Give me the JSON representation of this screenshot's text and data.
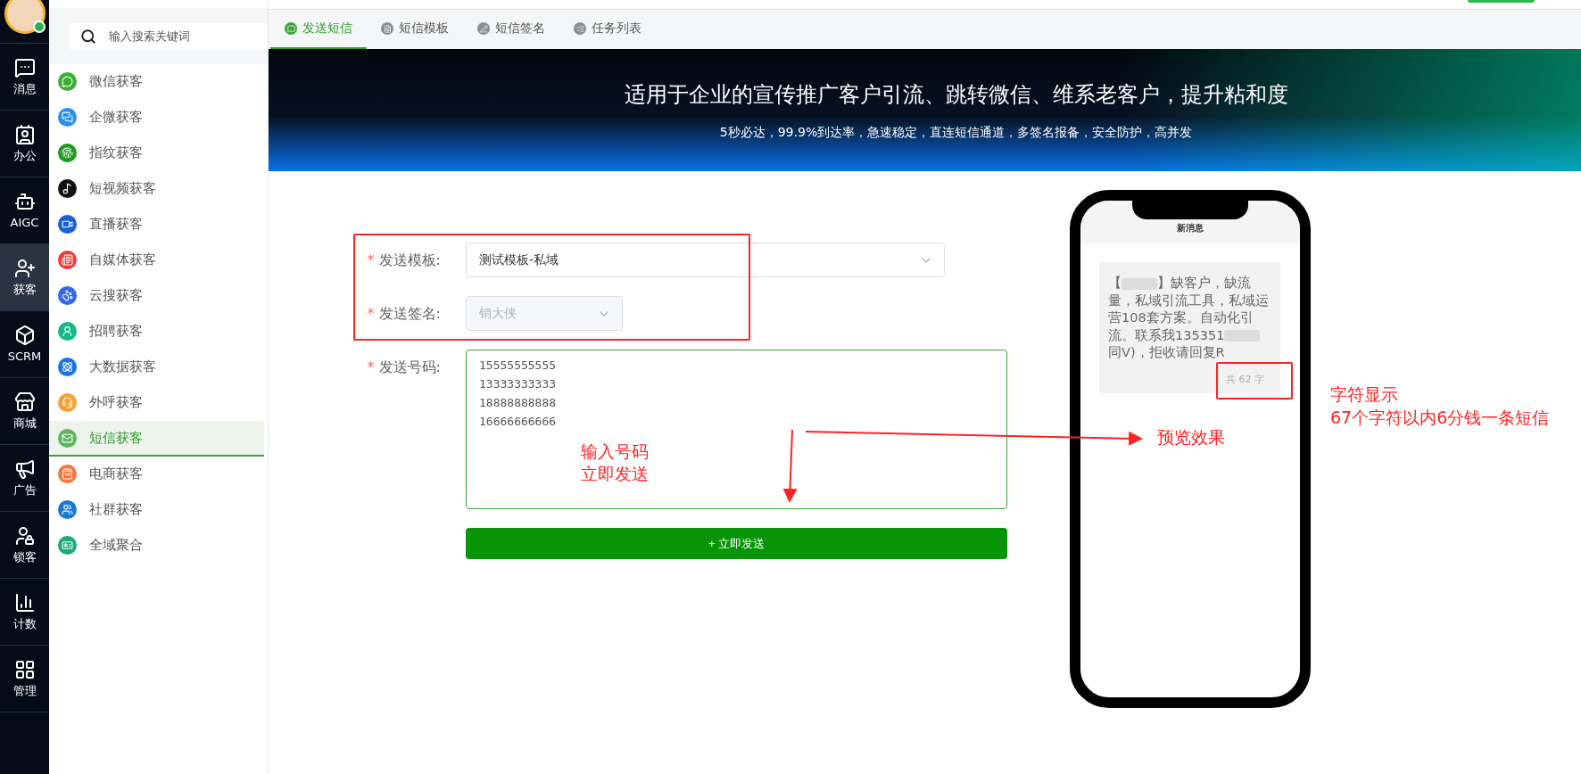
{
  "rail": {
    "items": [
      {
        "label": "消息",
        "selected": false
      },
      {
        "label": "办公",
        "selected": false
      },
      {
        "label": "AIGC",
        "selected": false
      },
      {
        "label": "获客",
        "selected": true
      },
      {
        "label": "SCRM",
        "selected": false
      },
      {
        "label": "商城",
        "selected": false
      },
      {
        "label": "广告",
        "selected": false
      },
      {
        "label": "锁客",
        "selected": false
      },
      {
        "label": "计数",
        "selected": false
      },
      {
        "label": "管理",
        "selected": false
      }
    ]
  },
  "sidebar": {
    "search": {
      "placeholder": "输入搜索关键词"
    },
    "items": [
      {
        "label": "微信获客",
        "selected": false,
        "color": "#3cb034"
      },
      {
        "label": "企微获客",
        "selected": false,
        "color": "#2b8ef0"
      },
      {
        "label": "指纹获客",
        "selected": false,
        "color": "#1a9b1a"
      },
      {
        "label": "短视频获客",
        "selected": false,
        "color": "#111111"
      },
      {
        "label": "直播获客",
        "selected": false,
        "color": "#1a5fd6"
      },
      {
        "label": "自媒体获客",
        "selected": false,
        "color": "#f03a3a"
      },
      {
        "label": "云搜获客",
        "selected": false,
        "color": "#3466f0"
      },
      {
        "label": "招聘获客",
        "selected": false,
        "color": "#16b88a"
      },
      {
        "label": "大数据获客",
        "selected": false,
        "color": "#1a74e8"
      },
      {
        "label": "外呼获客",
        "selected": false,
        "color": "#f5a034"
      },
      {
        "label": "短信获客",
        "selected": true,
        "color": "#5cb85c"
      },
      {
        "label": "电商获客",
        "selected": false,
        "color": "#f5773a"
      },
      {
        "label": "社群获客",
        "selected": false,
        "color": "#1878d8"
      },
      {
        "label": "全域聚合",
        "selected": false,
        "color": "#1aab7e"
      }
    ]
  },
  "tabs": [
    {
      "label": "发送短信",
      "selected": true
    },
    {
      "label": "短信模板",
      "selected": false
    },
    {
      "label": "短信签名",
      "selected": false
    },
    {
      "label": "任务列表",
      "selected": false
    }
  ],
  "banner": {
    "title": "适用于企业的宣传推广客户引流、跳转微信、维系老客户，提升粘和度",
    "subtitle": "5秒必达，99.9%到达率，急速稳定，直连短信通道，多签名报备，安全防护，高并发"
  },
  "form": {
    "fields": [
      {
        "kind": "select",
        "label": "发送模板:",
        "required_mark": "*",
        "value": "测试模板-私域",
        "disabled": false
      },
      {
        "kind": "select",
        "label": "发送签名:",
        "required_mark": "*",
        "value": "销大侠",
        "disabled": true
      },
      {
        "kind": "textarea",
        "label": "发送号码:",
        "required_mark": "*",
        "lines": [
          "15555555555",
          "13333333333",
          "18888888888",
          "16666666666"
        ]
      }
    ],
    "submit": "+ 立即发送"
  },
  "phone": {
    "header": "新消息",
    "message": [
      {
        "kind": "text",
        "text": "【"
      },
      {
        "kind": "blur"
      },
      {
        "kind": "text",
        "text": "】缺客户，缺流量，私域引流工具，私域运营108套方案。自动化引流。联系我135351"
      },
      {
        "kind": "blur"
      },
      {
        "kind": "text",
        "text": "同V)，拒收请回复R"
      }
    ],
    "count": "共 62 字"
  },
  "annotations": {
    "input_note": [
      "输入号码",
      "立即发送"
    ],
    "preview_note": "预览效果",
    "count_note": [
      "字符显示",
      "67个字符以内6分钱一条短信"
    ]
  }
}
